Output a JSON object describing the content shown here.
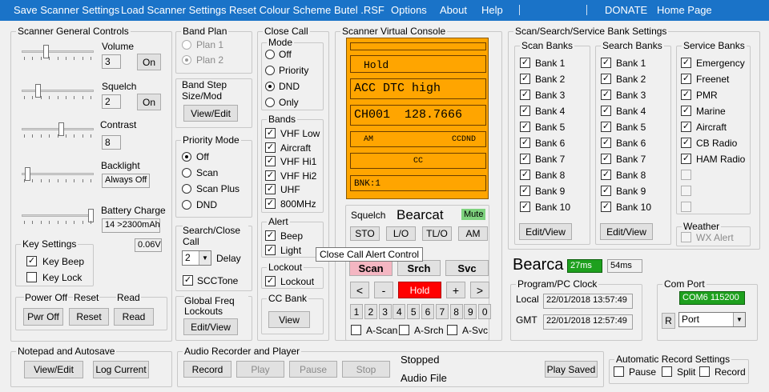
{
  "menu": {
    "items": [
      "Save Scanner Settings",
      "Load Scanner Settings",
      "Reset Colour Scheme",
      "Butel .RSF",
      "Options",
      "About",
      "Help",
      "DONATE",
      "Home Page"
    ]
  },
  "general": {
    "title": "Scanner General Controls",
    "volume_label": "Volume",
    "volume_value": "3",
    "squelch_label": "Squelch",
    "squelch_value": "2",
    "contrast_label": "Contrast",
    "contrast_value": "8",
    "backlight_label": "Backlight",
    "backlight_value": "Always Off",
    "battery_label": "Battery Charge",
    "battery_value": "14 >2300mAh",
    "voltage": "0.06V",
    "on_label": "On",
    "sliders": {
      "volume": 0.33,
      "squelch": 0.2,
      "contrast": 0.55,
      "backlight": 0.05,
      "battery": 1.0
    }
  },
  "key_settings": {
    "title": "Key Settings",
    "key_beep": "Key Beep",
    "key_beep_checked": true,
    "key_lock": "Key Lock",
    "key_lock_checked": false
  },
  "power": {
    "power_off_label": "Power Off",
    "reset_label": "Reset",
    "read_label": "Read",
    "pwr_off_btn": "Pwr Off",
    "reset_btn": "Reset",
    "read_btn": "Read"
  },
  "notepad": {
    "title": "Notepad and Autosave",
    "view_edit": "View/Edit",
    "log_current": "Log Current"
  },
  "band_plan": {
    "title": "Band Plan",
    "plan1": "Plan 1",
    "plan2": "Plan 2",
    "selected": "Plan 2"
  },
  "band_step": {
    "title": "Band Step Size/Mod",
    "btn": "View/Edit"
  },
  "priority": {
    "title": "Priority Mode",
    "options": [
      "Off",
      "Scan",
      "Scan Plus",
      "DND"
    ],
    "selected": "Off"
  },
  "search_close": {
    "title": "Search/Close Call",
    "value": "2",
    "delay_label": "Delay",
    "scc_tone": "SCCTone",
    "scc_tone_checked": true
  },
  "global_freq": {
    "title": "Global Freq Lockouts",
    "btn": "Edit/View"
  },
  "close_call": {
    "title": "Close Call",
    "mode_title": "Mode",
    "modes": [
      "Off",
      "Priority",
      "DND",
      "Only"
    ],
    "mode_selected": "DND",
    "bands_title": "Bands",
    "bands": [
      "VHF Low",
      "Aircraft",
      "VHF Hi1",
      "VHF Hi2",
      "UHF",
      "800MHz"
    ],
    "alert_title": "Alert",
    "beep": "Beep",
    "light": "Light",
    "lockout_title": "Lockout",
    "lockout": "Lockout",
    "cc_bank_title": "CC Bank",
    "cc_bank_btn": "View"
  },
  "tooltip": "Close Call Alert Control",
  "console": {
    "title": "Scanner Virtual Console",
    "line1": "Hold",
    "line2": "ACC DTC high",
    "channel": "CH001",
    "freq": "128.7666",
    "mod": "AM",
    "tone": "CCDND",
    "cc": "CC",
    "bank": "BNK:1",
    "squelch_label": "Squelch",
    "brand": "Bearcat",
    "mute": "Mute",
    "sto": "STO",
    "lo": "L/O",
    "tlo": "TL/O",
    "am": "AM",
    "scan": "Scan",
    "srch": "Srch",
    "svc": "Svc",
    "lt": "<",
    "minus": "-",
    "hold": "Hold",
    "plus": "+",
    "gt": ">",
    "digits": [
      "1",
      "2",
      "3",
      "4",
      "5",
      "6",
      "7",
      "8",
      "9",
      "0"
    ],
    "a_scan": "A-Scan",
    "a_srch": "A-Srch",
    "a_svc": "A-Svc",
    "colors": {
      "display": "#ffa500",
      "scan_btn": "#f4b6c2",
      "hold_btn": "#ff0000",
      "mute": "#7ed27e"
    }
  },
  "banks": {
    "title": "Scan/Search/Service Bank Settings",
    "scan_title": "Scan Banks",
    "scan": [
      "Bank 1",
      "Bank 2",
      "Bank 3",
      "Bank 4",
      "Bank 5",
      "Bank 6",
      "Bank 7",
      "Bank 8",
      "Bank 9",
      "Bank 10"
    ],
    "scan_btn": "Edit/View",
    "search_title": "Search Banks",
    "search": [
      "Bank 1",
      "Bank 2",
      "Bank 3",
      "Bank 4",
      "Bank 5",
      "Bank 6",
      "Bank 7",
      "Bank  8",
      "Bank 9",
      "Bank 10"
    ],
    "search_btn": "Edit/View",
    "service_title": "Service Banks",
    "service": [
      "Emergency",
      "Freenet",
      "PMR",
      "Marine",
      "Aircraft",
      "CB Radio",
      "HAM Radio"
    ],
    "weather_title": "Weather",
    "wx_alert": "WX Alert"
  },
  "status": {
    "brand": "Bearca",
    "ms1": "27ms",
    "ms2": "54ms"
  },
  "clock": {
    "title": "Program/PC Clock",
    "local_label": "Local",
    "local_value": "22/01/2018 13:57:49",
    "gmt_label": "GMT",
    "gmt_value": "22/01/2018 12:57:49"
  },
  "com_port": {
    "title": "Com Port",
    "status": "COM6 115200",
    "r_btn": "R",
    "port": "Port"
  },
  "audio": {
    "title": "Audio Recorder and Player",
    "record": "Record",
    "play": "Play",
    "pause": "Pause",
    "stop": "Stop",
    "status": "Stopped",
    "file_label": "Audio File",
    "play_saved": "Play Saved"
  },
  "auto_record": {
    "title": "Automatic Record Settings",
    "pause": "Pause",
    "split": "Split",
    "record": "Record"
  }
}
